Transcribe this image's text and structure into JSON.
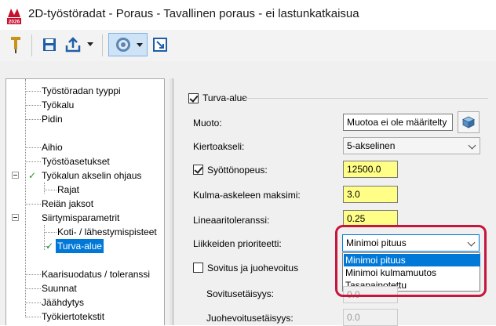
{
  "window": {
    "title": "2D-työstöradat - Poraus - Tavallinen poraus - ei lastunkatkaisua"
  },
  "logo": {
    "text": "2026"
  },
  "toolbar": {
    "icons": [
      "pin-icon",
      "save-icon",
      "export-icon",
      "dropdown-arrow",
      "tool-view-icon",
      "dropdown-arrow",
      "pick-icon"
    ]
  },
  "tree": {
    "items": [
      {
        "label": "Työstöradan tyyppi"
      },
      {
        "label": "Työkalu"
      },
      {
        "label": "Pidin"
      },
      {
        "label": "Aihio"
      },
      {
        "label": "Työstöasetukset"
      },
      {
        "label": "Työkalun akselin ohjaus",
        "checked": true
      },
      {
        "label": "Rajat"
      },
      {
        "label": "Reiän jaksot"
      },
      {
        "label": "Siirtymisparametrit"
      },
      {
        "label": "Koti- / lähestymispisteet"
      },
      {
        "label": "Turva-alue",
        "checked": true,
        "selected": true
      },
      {
        "label": "Kaarisuodatus / toleranssi"
      },
      {
        "label": "Suunnat"
      },
      {
        "label": "Jäähdytys"
      },
      {
        "label": "Työkiertotekstit"
      }
    ]
  },
  "panel": {
    "section_title": "Turva-alue",
    "shape_label": "Muoto:",
    "shape_value": "Muotoa ei ole määritelty",
    "rotation_axis_label": "Kiertoakseli:",
    "rotation_axis_value": "5-akselinen",
    "feed_label": "Syöttönopeus:",
    "feed_value": "12500.0",
    "angle_step_label": "Kulma-askeleen maksimi:",
    "angle_step_value": "3.0",
    "linear_tol_label": "Lineaaritoleranssi:",
    "linear_tol_value": "0.25",
    "priority_label": "Liikkeiden prioriteetti:",
    "priority_value": "Minimoi pituus",
    "priority_options": [
      "Minimoi pituus",
      "Minimoi kulmamuutos",
      "Tasapainotettu"
    ],
    "smoothing_label": "Sovitus ja juohevoitus",
    "fit_distance_label": "Sovitusetäisyys:",
    "fit_distance_value": "0.0",
    "smooth_distance_label": "Juohevoitusetäisyys:",
    "smooth_distance_value": "0.0"
  },
  "colors": {
    "accent": "#0078d7",
    "highlight_ring": "#c6163b",
    "input_yellow": "#ffff88",
    "check_green": "#1a9a2c"
  }
}
